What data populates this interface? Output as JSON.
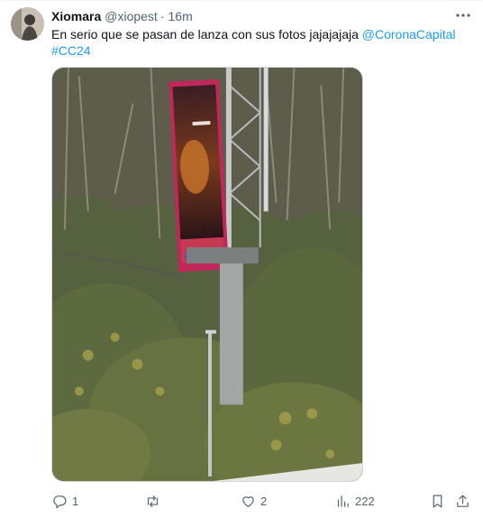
{
  "tweet": {
    "display_name": "Xiomara",
    "handle": "@xiopest",
    "separator": "·",
    "time": "16m",
    "text_before": "En serio que se pasan de lanza con sus fotos jajajajaja ",
    "mention": "@CoronaCapital",
    "hashtag": "#CC24"
  },
  "actions": {
    "replies": "1",
    "retweets": "",
    "likes": "2",
    "views": "222"
  },
  "colors": {
    "link": "#1d9bf0",
    "secondary_text": "#536471",
    "primary_text": "#0f1419"
  },
  "icons": [
    "more-icon",
    "reply-icon",
    "retweet-icon",
    "like-icon",
    "views-icon",
    "bookmark-icon",
    "share-icon"
  ]
}
